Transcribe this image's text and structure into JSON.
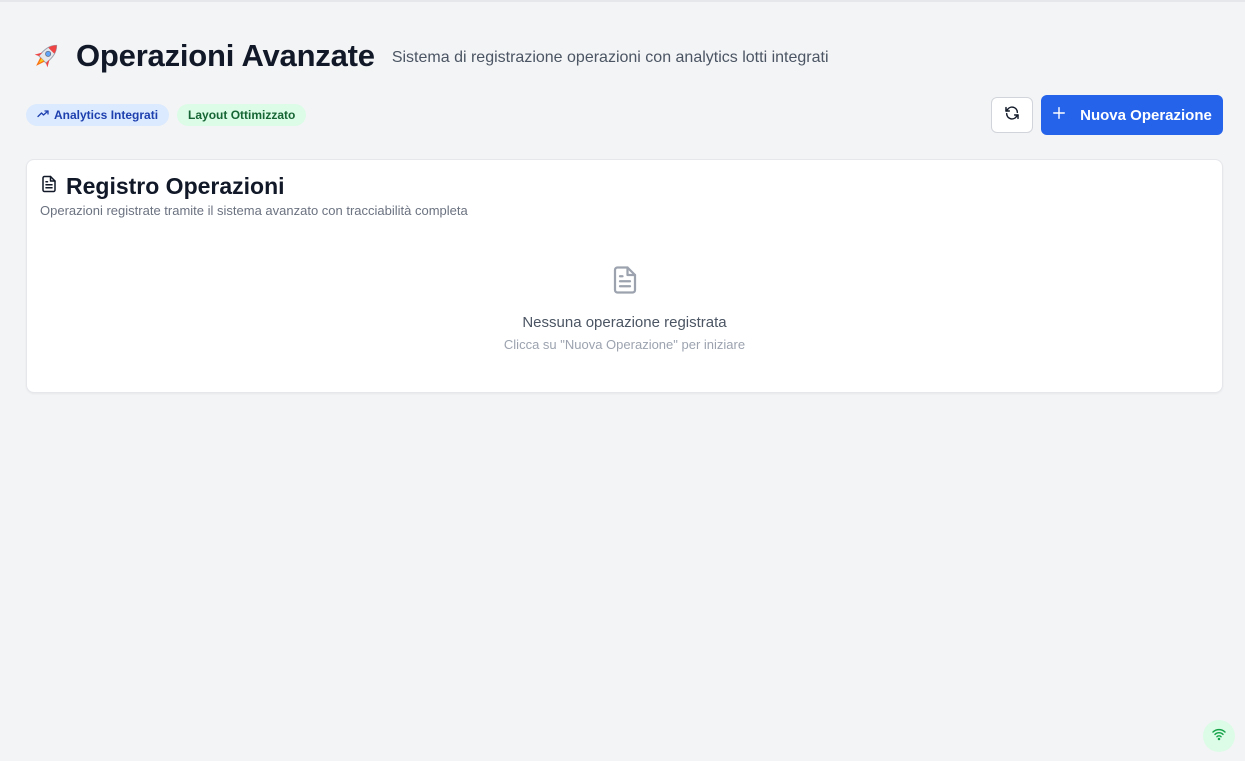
{
  "header": {
    "title": "Operazioni Avanzate",
    "subtitle": "Sistema di registrazione operazioni con analytics lotti integrati",
    "icon": "rocket-icon"
  },
  "badges": [
    {
      "label": "Analytics Integrati",
      "icon": "trending-up-icon",
      "color": "#1e40af",
      "background": "#dbeafe"
    },
    {
      "label": "Layout Ottimizzato",
      "color": "#166534",
      "background": "#dcfce7"
    }
  ],
  "toolbar": {
    "refresh_icon": "refresh-icon",
    "new_operation_label": "Nuova Operazione",
    "accent": "#2563eb"
  },
  "register": {
    "title": "Registro Operazioni",
    "description": "Operazioni registrate tramite il sistema avanzato con tracciabilità completa",
    "empty_title": "Nessuna operazione registrata",
    "empty_hint": "Clicca su \"Nuova Operazione\" per iniziare"
  },
  "status": {
    "connection_icon": "wifi-icon",
    "color": "#16a34a"
  }
}
